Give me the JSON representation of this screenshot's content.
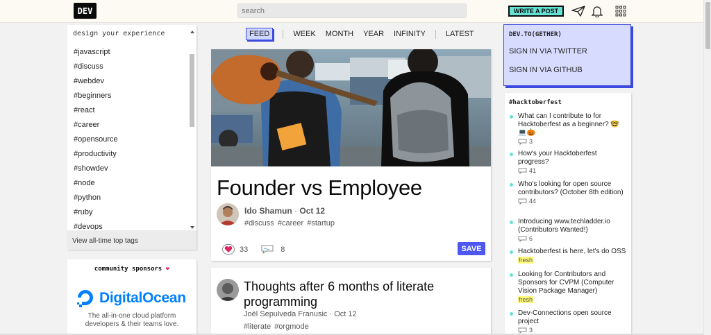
{
  "header": {
    "logo": "DEV",
    "search_placeholder": "search",
    "write_post": "WRITE A POST"
  },
  "sidebar": {
    "title": "design your experience",
    "tags": [
      "#javascript",
      "#discuss",
      "#webdev",
      "#beginners",
      "#react",
      "#career",
      "#opensource",
      "#productivity",
      "#showdev",
      "#node",
      "#python",
      "#ruby",
      "#devops"
    ],
    "footer": "View all-time top tags",
    "sponsors_title": "community sponsors",
    "sponsor_name": "DigitalOcean",
    "sponsor_desc": "The all-in-one cloud platform developers & their teams love."
  },
  "feed_nav": {
    "feed": "FEED",
    "week": "WEEK",
    "month": "MONTH",
    "year": "YEAR",
    "infinity": "INFINITY",
    "latest": "LATEST"
  },
  "articles": [
    {
      "title": "Founder vs Employee",
      "author": "Ido Shamun",
      "date": "Oct 12",
      "tags": "#discuss #career #startup",
      "reactions": "33",
      "comments": "8",
      "save": "SAVE"
    },
    {
      "title": "Thoughts after 6 months of literate programming",
      "author": "Joël Sepulveda Franusic",
      "date": "Oct 12",
      "tags": "#literate #orgmode"
    }
  ],
  "gether": {
    "title": "DEV.TO(GETHER)",
    "twitter": "SIGN IN VIA TWITTER",
    "github": "SIGN IN VIA GITHUB"
  },
  "hacktoberfest": {
    "title": "#hacktoberfest",
    "items": [
      {
        "title": "What can I contribute to for Hacktoberfest as a beginner? 🤓💻🎃",
        "comments": "3"
      },
      {
        "title": "How's your Hacktoberfest progress?",
        "comments": "41"
      },
      {
        "title": "Who's looking for open source contributors? (October 8th edition)",
        "comments": "44"
      },
      {
        "title": "Introducing www.techladder.io (Contributors Wanted!)",
        "comments": "6"
      },
      {
        "title": "Hacktoberfest is here, let's do OSS",
        "badge": "fresh"
      },
      {
        "title": "Looking for Contributors and Sponsors for CVPM (Computer Vision Package Manager)",
        "badge": "fresh"
      },
      {
        "title": "Dev-Connections open source project",
        "comments": "3"
      }
    ]
  }
}
